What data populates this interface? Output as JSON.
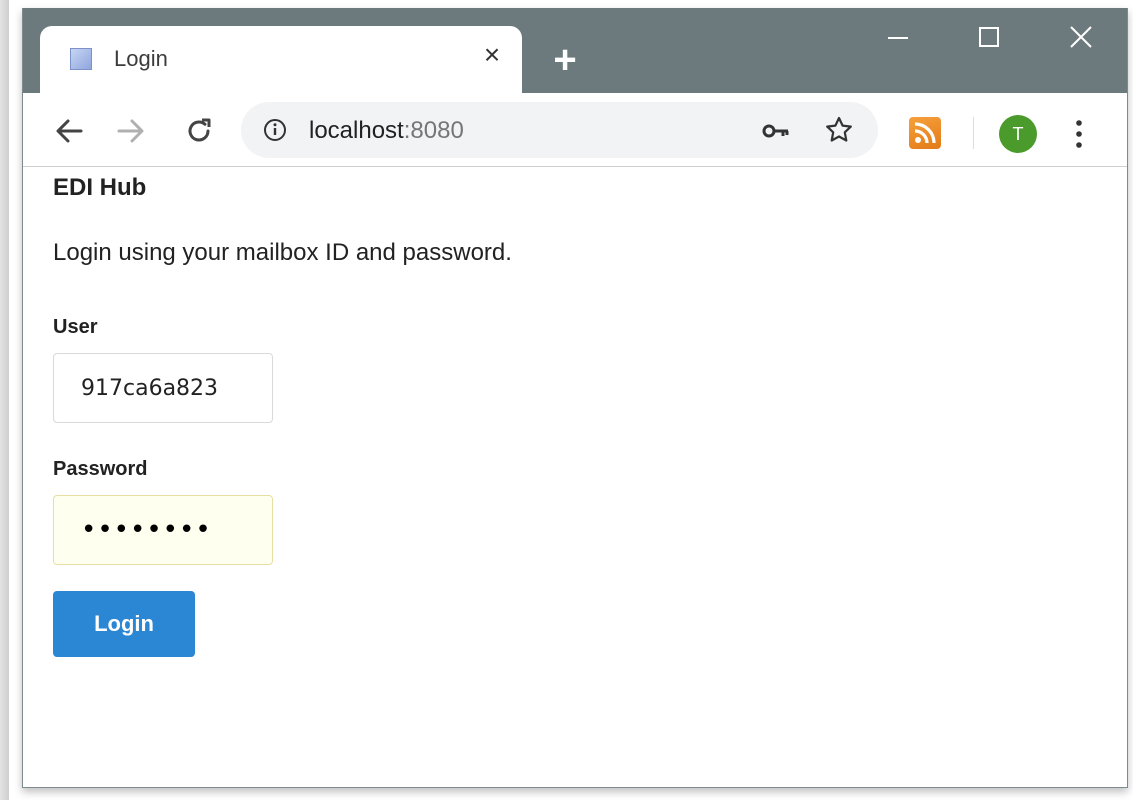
{
  "browser": {
    "tab": {
      "title": "Login",
      "favicon": "page-favicon-icon",
      "close": "×"
    },
    "new_tab": "+",
    "window_controls": {
      "minimize": "minimize-icon",
      "maximize": "maximize-icon",
      "close": "close-icon"
    },
    "address": {
      "host": "localhost",
      "port": ":8080"
    },
    "profile_initial": "T",
    "colors": {
      "titlebar": "#6c797d",
      "avatar": "#4a9a2c",
      "rss": "#f08c26"
    }
  },
  "page": {
    "app_title": "EDI Hub",
    "intro": "Login using your mailbox ID and password.",
    "user_label": "User",
    "user_value": "917ca6a823",
    "password_label": "Password",
    "password_masked": "••••••••",
    "login_button": "Login",
    "colors": {
      "login_button": "#2b87d3",
      "autofill_bg": "#fffff0"
    }
  }
}
